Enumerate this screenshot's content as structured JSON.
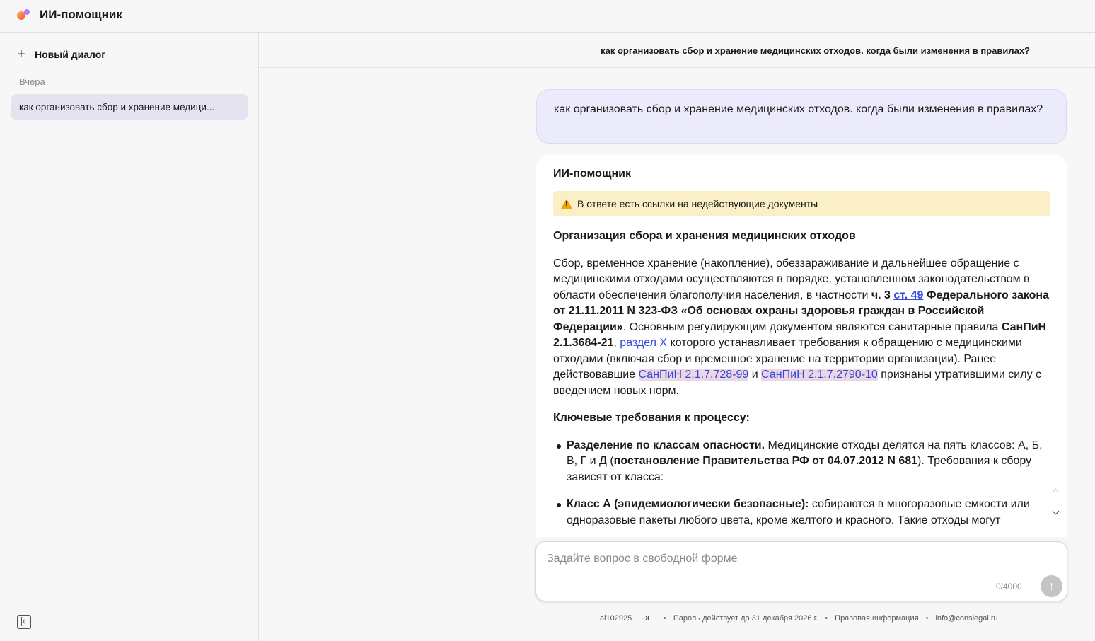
{
  "app": {
    "title": "ИИ-помощник"
  },
  "sidebar": {
    "new_dialog_label": "Новый диалог",
    "group_label": "Вчера",
    "items": [
      {
        "label": "как организовать сбор и хранение медици..."
      }
    ]
  },
  "chat": {
    "title": "как организовать сбор и хранение медицинских отходов. когда были изменения в правилах?",
    "user_message": "как организовать сбор и хранение медицинских отходов. когда были изменения в правилах?",
    "assistant_name": "ИИ-помощник",
    "warning": "В ответе есть ссылки на недействующие документы",
    "heading": "Организация сбора и хранения медицинских отходов",
    "p1": {
      "t1": "Сбор, временное хранение (накопление), обеззараживание и дальнейшее обращение с медицинскими отходами осуществляются в порядке, установленном законодательством в области обеспечения благополучия населения, в частности ",
      "b1": "ч. 3",
      "link1": "ст. 49",
      "b2": "Федерального закона от 21.11.2011 N 323-ФЗ «Об основах охраны здоровья граждан в Российской Федерации»",
      "t2": ". Основным регулирующим документом являются санитарные правила ",
      "b3": "СанПиН 2.1.3684-21",
      "t3": ", ",
      "link2": "раздел X",
      "t4": " которого устанавливает требования к обращению с медицинскими отходами (включая сбор и временное хранение на территории организации). Ранее действовавшие ",
      "link3": "СанПиН 2.1.7.728-99",
      "t5": " и ",
      "link4": "СанПиН 2.1.7.2790-10",
      "t6": " признаны утратившими силу с введением новых норм."
    },
    "subheading": "Ключевые требования к процессу:",
    "bullets": [
      {
        "bold": "Разделение по классам опасности.",
        "t1": " Медицинские отходы делятся на пять классов: А, Б, В, Г и Д (",
        "bold2": "постановление Правительства РФ от 04.07.2012 N 681",
        "t2": "). Требования к сбору зависят от класса:"
      },
      {
        "bold": "Класс А (эпидемиологически безопасные):",
        "t1": " собираются в многоразовые емкости или одноразовые пакеты любого цвета, кроме желтого и красного. Такие отходы могут"
      }
    ]
  },
  "composer": {
    "placeholder": "Задайте вопрос в свободной форме",
    "char_count": "0/4000"
  },
  "footer": {
    "user_id": "ai102925",
    "password_info": "Пароль действует до 31 декабря 2026 г.",
    "legal": "Правовая информация",
    "email": "info@conslegal.ru",
    "separator": "•"
  },
  "colors": {
    "accent": "#ecebfc",
    "link": "#3049d9",
    "warning_bg": "#fbefc7",
    "invalid_link_bg": "#ecd6e3"
  }
}
